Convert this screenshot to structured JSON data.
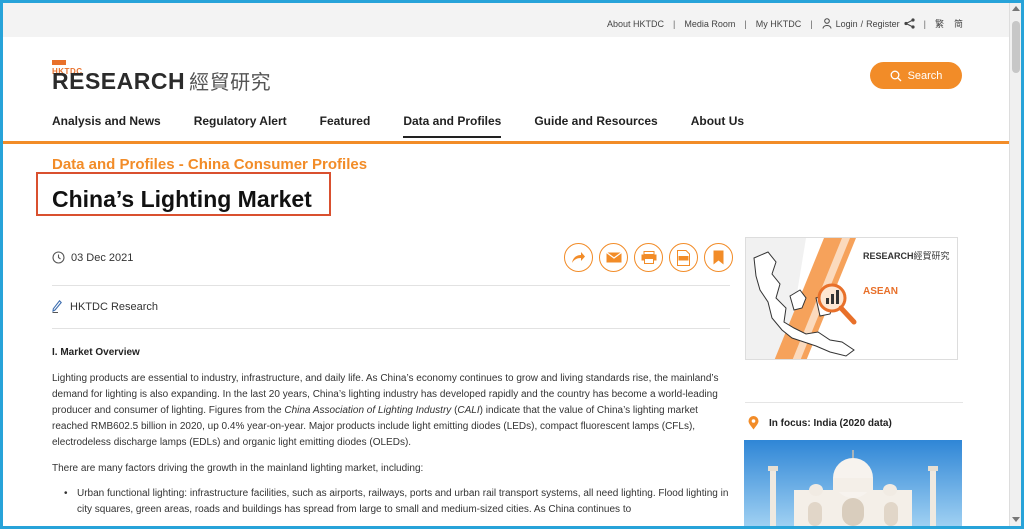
{
  "top_links": {
    "about": "About HKTDC",
    "media": "Media Room",
    "my": "My HKTDC",
    "login": "Login",
    "slash": "/",
    "register": "Register",
    "lang_tc": "繁",
    "lang_sc": "简"
  },
  "logo": {
    "small": "HKTDC",
    "main": "RESEARCH",
    "cn": "經貿研究"
  },
  "search": {
    "label": "Search"
  },
  "nav": {
    "items": [
      {
        "label": "Analysis and News"
      },
      {
        "label": "Regulatory Alert"
      },
      {
        "label": "Featured"
      },
      {
        "label": "Data and Profiles"
      },
      {
        "label": "Guide and Resources"
      },
      {
        "label": "About Us"
      }
    ]
  },
  "article": {
    "category": "Data and Profiles - China Consumer Profiles",
    "title": "China’s Lighting Market",
    "date": "03 Dec 2021",
    "author": "HKTDC Research",
    "section": "I. Market Overview",
    "p1_a": "Lighting products are essential to industry, infrastructure, and daily life. As China’s economy continues to grow and living standards rise, the mainland’s demand for lighting is also expanding. In the last 20 years, China’s lighting industry has developed rapidly and the country has become a world-leading producer and consumer of lighting. Figures from the ",
    "p1_ital1": "China Association of Lighting Industry",
    "p1_b": " (",
    "p1_ital2": "CALI",
    "p1_c": ") indicate that the value of China’s lighting market reached RMB602.5 billion in 2020, up 0.4% year-on-year. Major products include light emitting diodes (LEDs), compact fluorescent lamps (CFLs), electrodeless discharge lamps (EDLs) and organic light emitting diodes (OLEDs).",
    "p2": "There are many factors driving the growth in the mainland lighting market, including:",
    "bullet1": "Urban functional lighting: infrastructure facilities, such as airports, railways, ports and urban rail transport systems, all need lighting. Flood lighting in city squares, green areas, roads and buildings has spread from large to small and medium-sized cities. As China continues to"
  },
  "sidebar": {
    "asean_logo_main": "RESEARCH",
    "asean_logo_cn": "經貿研究",
    "asean_label": "ASEAN",
    "focus_title": "In focus: India (2020 data)"
  },
  "colors": {
    "accent": "#f28c28",
    "frame": "#27a3d9",
    "title_box": "#d9502f"
  }
}
